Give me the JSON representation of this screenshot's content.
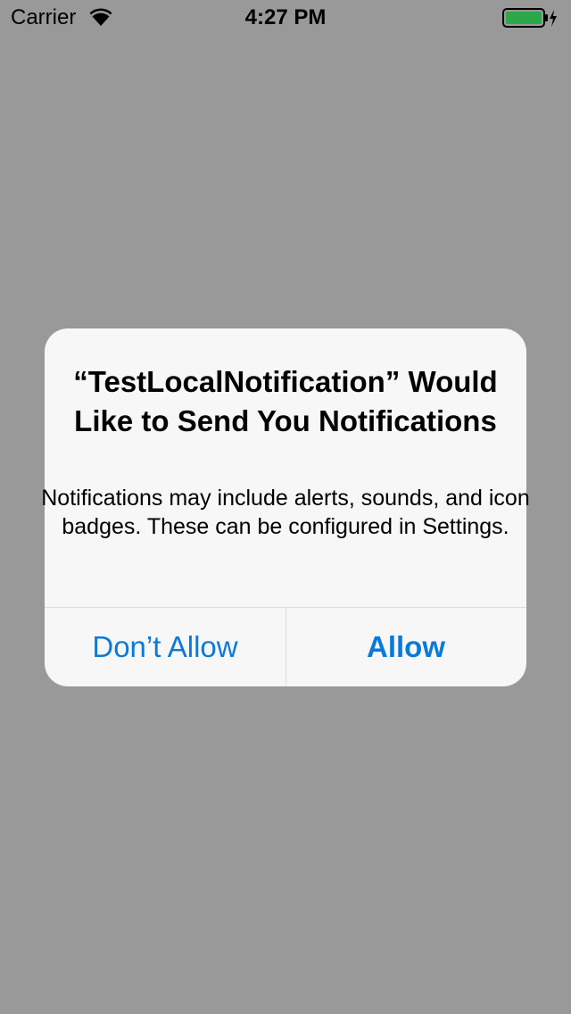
{
  "status_bar": {
    "carrier": "Carrier",
    "time": "4:27 PM",
    "wifi_icon": "wifi-icon",
    "battery_icon": "battery-charging-icon",
    "battery_color": "#2ba84a"
  },
  "alert": {
    "title": "“TestLocalNotification” Would Like to Send You Notifications",
    "message": "Notifications may include alerts, sounds, and icon badges. These can be configured in Settings.",
    "buttons": {
      "dont_allow": "Don’t Allow",
      "allow": "Allow"
    },
    "accent_color": "#0a7ad8"
  },
  "colors": {
    "background_dim": "#999999",
    "alert_background": "#f7f7f7"
  }
}
